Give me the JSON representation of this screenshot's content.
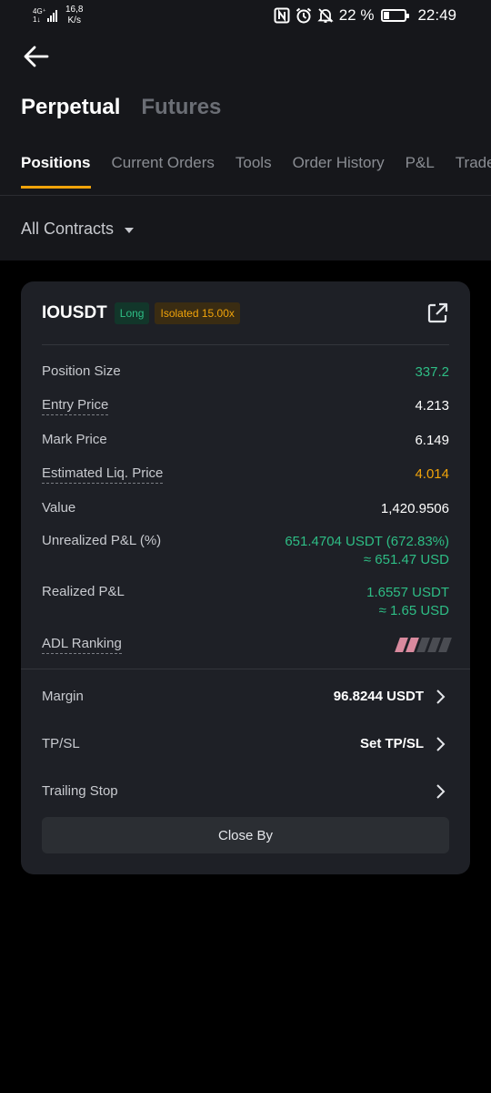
{
  "status_bar": {
    "network_top": "4G⁺",
    "network_bottom": "1↓",
    "speed_value": "16,8",
    "speed_unit": "K/s",
    "battery_text": "22 %",
    "battery_level_percent": 22,
    "time": "22:49",
    "icons": [
      "nfc-icon",
      "alarm-icon",
      "mute-icon",
      "battery-icon"
    ]
  },
  "header": {
    "title_active": "Perpetual",
    "title_inactive": "Futures"
  },
  "tabs": [
    "Positions",
    "Current Orders",
    "Tools",
    "Order History",
    "P&L",
    "Trade"
  ],
  "filter": {
    "label": "All Contracts"
  },
  "position": {
    "symbol": "IOUSDT",
    "side_badge": "Long",
    "margin_badge": "Isolated 15.00x",
    "rows": {
      "position_size": {
        "label": "Position Size",
        "value": "337.2"
      },
      "entry_price": {
        "label": "Entry Price",
        "value": "4.213"
      },
      "mark_price": {
        "label": "Mark Price",
        "value": "6.149"
      },
      "liq_price": {
        "label": "Estimated Liq. Price",
        "value": "4.014"
      },
      "value": {
        "label": "Value",
        "value": "1,420.9506"
      },
      "unrealized": {
        "label": "Unrealized P&L (%)",
        "value_line1": "651.4704 USDT (672.83%)",
        "value_line2": "≈ 651.47 USD"
      },
      "realized": {
        "label": "Realized P&L",
        "value_line1": "1.6557 USDT",
        "value_line2": "≈ 1.65 USD"
      },
      "adl": {
        "label": "ADL Ranking",
        "level": 2,
        "max": 5
      }
    },
    "margin": {
      "label": "Margin",
      "value": "96.8244 USDT"
    },
    "tpsl": {
      "label": "TP/SL",
      "value": "Set TP/SL"
    },
    "trailing": {
      "label": "Trailing Stop"
    },
    "close_button": "Close By"
  },
  "colors": {
    "green": "#2ebd85",
    "orange": "#f0a30a",
    "adl_active": "#d98a9e",
    "adl_inactive": "#4a4c52"
  }
}
